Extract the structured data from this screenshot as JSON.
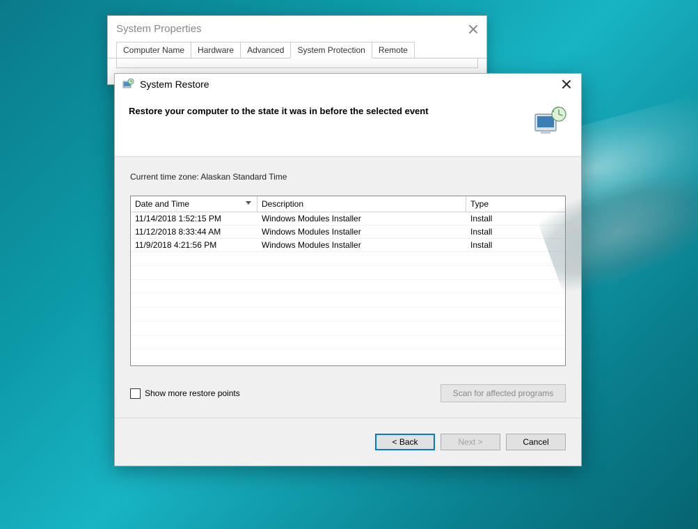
{
  "sysprop": {
    "title": "System Properties",
    "tabs": [
      "Computer Name",
      "Hardware",
      "Advanced",
      "System Protection",
      "Remote"
    ],
    "active_tab_index": 3
  },
  "wizard": {
    "title": "System Restore",
    "heading": "Restore your computer to the state it was in before the selected event",
    "timezone_label": "Current time zone: Alaskan Standard Time",
    "columns": {
      "datetime": "Date and Time",
      "description": "Description",
      "type": "Type"
    },
    "rows": [
      {
        "datetime": "11/14/2018 1:52:15 PM",
        "description": "Windows Modules Installer",
        "type": "Install"
      },
      {
        "datetime": "11/12/2018 8:33:44 AM",
        "description": "Windows Modules Installer",
        "type": "Install"
      },
      {
        "datetime": "11/9/2018 4:21:56 PM",
        "description": "Windows Modules Installer",
        "type": "Install"
      }
    ],
    "show_more_label": "Show more restore points",
    "scan_button": "Scan for affected programs",
    "buttons": {
      "back": "< Back",
      "next": "Next >",
      "cancel": "Cancel"
    }
  }
}
